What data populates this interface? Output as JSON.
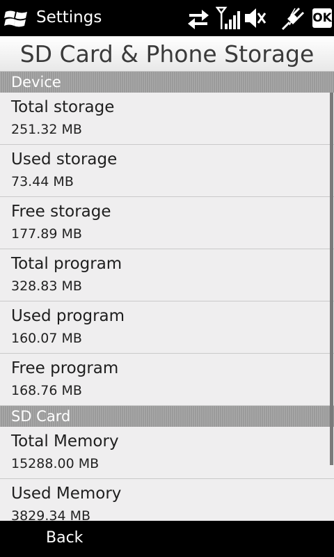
{
  "status_bar": {
    "app_title": "Settings",
    "ok_label": "OK",
    "icons": [
      "windows-start-icon",
      "data-transfer-icon",
      "signal-strength-icon",
      "speaker-muted-icon",
      "charging-plug-icon"
    ]
  },
  "page": {
    "title": "SD Card & Phone Storage"
  },
  "sections": {
    "device": {
      "title": "Device",
      "items": [
        {
          "label": "Total storage",
          "value": "251.32 MB"
        },
        {
          "label": "Used storage",
          "value": "73.44 MB"
        },
        {
          "label": "Free storage",
          "value": "177.89 MB"
        },
        {
          "label": "Total program",
          "value": "328.83 MB"
        },
        {
          "label": "Used program",
          "value": "160.07 MB"
        },
        {
          "label": "Free program",
          "value": "168.76 MB"
        }
      ]
    },
    "sd_card": {
      "title": "SD Card",
      "items": [
        {
          "label": "Total Memory",
          "value": "15288.00 MB"
        },
        {
          "label": "Used Memory",
          "value": "3829.34 MB"
        }
      ]
    }
  },
  "bottom_bar": {
    "back_label": "Back"
  },
  "colors": {
    "background": "#efeeef",
    "section_header": "#9a9a9a",
    "bar": "#000000"
  }
}
